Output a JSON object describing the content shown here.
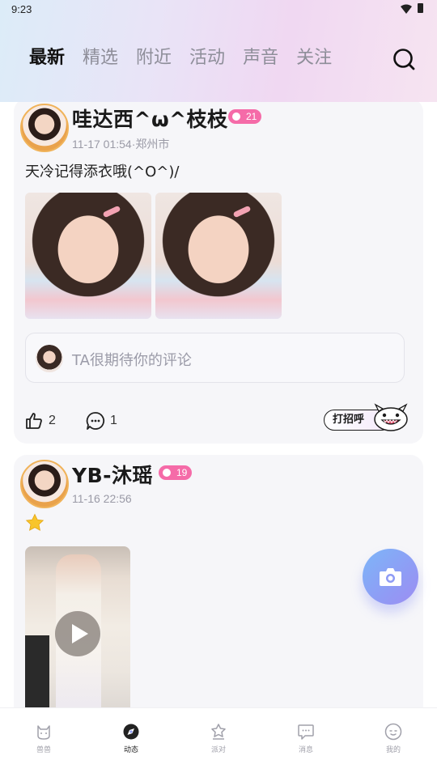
{
  "status_bar": {
    "time": "9:23"
  },
  "tabs": [
    {
      "label": "最新",
      "active": true
    },
    {
      "label": "精选",
      "active": false
    },
    {
      "label": "附近",
      "active": false
    },
    {
      "label": "活动",
      "active": false
    },
    {
      "label": "声音",
      "active": false
    },
    {
      "label": "关注",
      "active": false
    }
  ],
  "posts": [
    {
      "username": "哇达西^ω^枝枝",
      "level": "21",
      "meta": "11-17 01:54·郑州市",
      "text": "天冷记得添衣哦(^O^)/",
      "comment_placeholder": "TA很期待你的评论",
      "likes": "2",
      "comments": "1",
      "greet_label": "打招呼"
    },
    {
      "username": "YB-沐瑶",
      "level": "19",
      "meta": "11-16 22:56",
      "emoji": "star-emoji"
    }
  ],
  "bottom_nav": [
    {
      "label": "兽兽",
      "icon": "cat-face-icon",
      "active": false
    },
    {
      "label": "动态",
      "icon": "compass-icon",
      "active": true
    },
    {
      "label": "派对",
      "icon": "party-icon",
      "active": false
    },
    {
      "label": "消息",
      "icon": "message-icon",
      "active": false
    },
    {
      "label": "我的",
      "icon": "profile-face-icon",
      "active": false
    }
  ],
  "colors": {
    "badge": "#f56ba8",
    "fab": "#8f9cf5",
    "tab_active": "#111111",
    "tab_inactive": "#8e8e99"
  }
}
